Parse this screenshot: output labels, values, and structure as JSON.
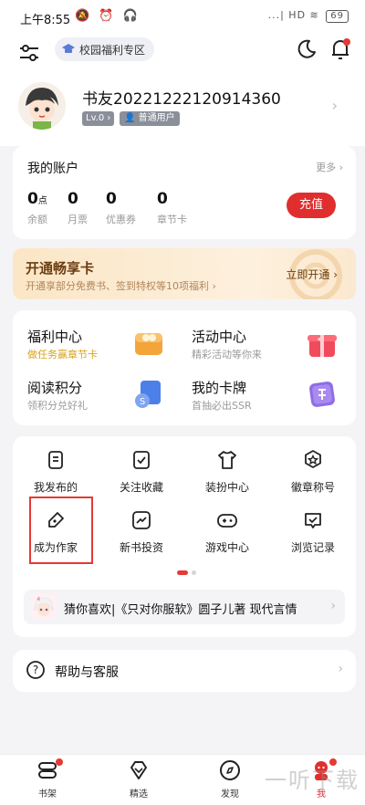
{
  "status_bar": {
    "time": "上午8:55",
    "icons": "🔕 ⏰ 🎧",
    "network": "...| HD ≋",
    "battery": "69"
  },
  "top_bar": {
    "campus_label": "校园福利专区"
  },
  "profile": {
    "username": "书友20221222120914360",
    "level": "Lv.0 ›",
    "user_type": "普通用户"
  },
  "account": {
    "title": "我的账户",
    "more": "更多 ›",
    "items": [
      {
        "value": "0",
        "unit": "点",
        "label": "余额"
      },
      {
        "value": "0",
        "unit": "",
        "label": "月票"
      },
      {
        "value": "0",
        "unit": "",
        "label": "优惠券"
      },
      {
        "value": "0",
        "unit": "",
        "label": "章节卡"
      }
    ],
    "recharge": "充值"
  },
  "vip": {
    "title": "开通畅享卡",
    "desc": "开通享部分免费书、签到特权等10项福利 ›",
    "action": "立即开通"
  },
  "benefits": [
    {
      "title": "福利中心",
      "desc": "做任务赢章节卡",
      "desc_color": "#d9a21b",
      "icon": "coin-box-icon"
    },
    {
      "title": "活动中心",
      "desc": "精彩活动等你来",
      "desc_color": "#9a9a9a",
      "icon": "gift-icon"
    },
    {
      "title": "阅读积分",
      "desc": "领积分兑好礼",
      "desc_color": "#9a9a9a",
      "icon": "points-book-icon"
    },
    {
      "title": "我的卡牌",
      "desc": "首抽必出SSR",
      "desc_color": "#9a9a9a",
      "icon": "card-icon"
    }
  ],
  "tools": [
    {
      "label": "我发布的",
      "icon": "document-icon"
    },
    {
      "label": "关注收藏",
      "icon": "check-doc-icon"
    },
    {
      "label": "装扮中心",
      "icon": "tshirt-icon"
    },
    {
      "label": "徽章称号",
      "icon": "badge-icon"
    },
    {
      "label": "成为作家",
      "icon": "pen-icon"
    },
    {
      "label": "新书投资",
      "icon": "trend-icon"
    },
    {
      "label": "游戏中心",
      "icon": "gamepad-icon"
    },
    {
      "label": "浏览记录",
      "icon": "history-icon"
    }
  ],
  "recommend": {
    "text": "猜你喜欢|《只对你服软》圆子儿著 现代言情"
  },
  "help": {
    "label": "帮助与客服"
  },
  "nav": [
    {
      "label": "书架",
      "icon": "bookshelf-icon",
      "active": false
    },
    {
      "label": "精选",
      "icon": "diamond-icon",
      "active": false
    },
    {
      "label": "发现",
      "icon": "compass-icon",
      "active": false
    },
    {
      "label": "我",
      "icon": "profile-icon",
      "active": true
    }
  ],
  "watermark": "一听下载",
  "colors": {
    "accent": "#e02e2e",
    "vip_text": "#6b3d10",
    "page_bg": "#f4f4f6"
  }
}
